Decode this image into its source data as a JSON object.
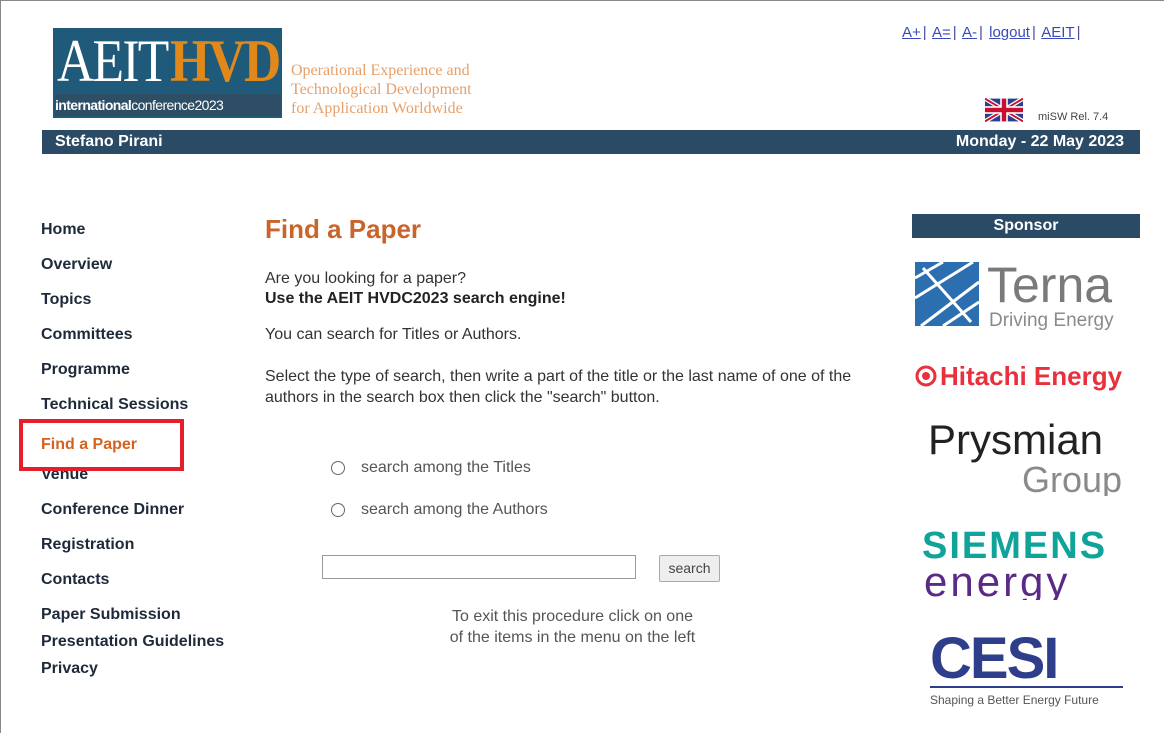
{
  "header": {
    "logo": {
      "aeit": "AEIT",
      "hvdc": "HVDC",
      "subline_bold": "international",
      "subline_rest": "conference2023"
    },
    "tagline": [
      "Operational Experience and",
      "Technological Development",
      "for Application Worldwide"
    ],
    "links": [
      "A+",
      "A=",
      "A-",
      "logout",
      "AEIT"
    ],
    "release": "miSW Rel. 7.4",
    "user": "Stefano Pirani",
    "date": "Monday - 22 May 2023"
  },
  "nav": {
    "items": [
      {
        "label": "Home"
      },
      {
        "label": "Overview"
      },
      {
        "label": "Topics"
      },
      {
        "label": "Committees"
      },
      {
        "label": "Programme"
      },
      {
        "label": "Technical Sessions"
      },
      {
        "label": "Find a Paper"
      },
      {
        "label": "Venue"
      },
      {
        "label": "Conference Dinner"
      },
      {
        "label": "Registration"
      },
      {
        "label": "Contacts"
      },
      {
        "label": "Paper Submission"
      },
      {
        "label": "Presentation Guidelines"
      },
      {
        "label": "Privacy"
      }
    ],
    "active": "Find a Paper"
  },
  "main": {
    "title": "Find a Paper",
    "question": "Are you looking for a paper?",
    "engine": "Use the AEIT HVDC2023 search engine!",
    "info": "You can search for Titles or Authors.",
    "instructions": "Select the type of search, then write a part of the title or the last name of one of the authors in the search box then click the \"search\" button.",
    "radio_titles": "search among the Titles",
    "radio_authors": "search among the Authors",
    "search_value": "",
    "search_button": "search",
    "exit_line1": "To exit this procedure click on one",
    "exit_line2": "of the items in the menu on the left"
  },
  "sponsors": {
    "heading": "Sponsor",
    "terna": {
      "name": "Terna",
      "tagline": "Driving Energy"
    },
    "hitachi": "Hitachi Energy",
    "prysmian": {
      "name": "Prysmian",
      "group": "Group"
    },
    "siemens": {
      "line1": "SIEMENS",
      "line2": "energy"
    },
    "cesi": {
      "name": "CESI",
      "tagline": "Shaping a Better Energy Future"
    }
  },
  "colors": {
    "bar": "#2b4a66",
    "accent_orange": "#d4621d",
    "highlight_red": "#e41e2a",
    "link_blue": "#3a4aba"
  }
}
